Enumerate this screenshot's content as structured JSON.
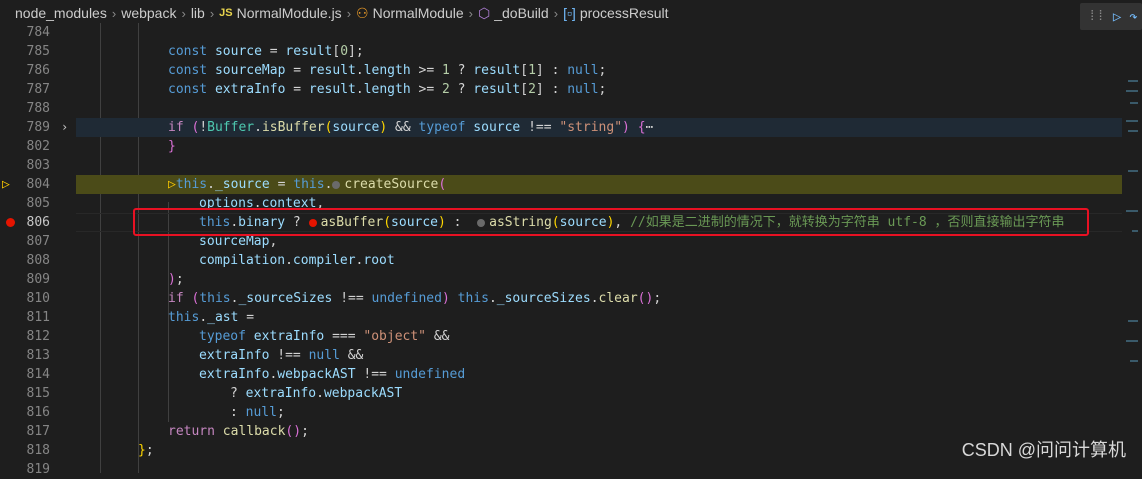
{
  "breadcrumb": {
    "items": [
      "node_modules",
      "webpack",
      "lib",
      "NormalModule.js",
      "NormalModule",
      "_doBuild",
      "processResult"
    ],
    "js_badge": "JS"
  },
  "debug_toolbar": {
    "grip": "⁞⁞",
    "continue": "▷",
    "step_over": "↷"
  },
  "lines": [
    {
      "n": "784",
      "segs": []
    },
    {
      "n": "785",
      "segs": [
        [
          "kw",
          "const "
        ],
        [
          "var",
          "source"
        ],
        [
          "pun",
          " = "
        ],
        [
          "var",
          "result"
        ],
        [
          "pun",
          "["
        ],
        [
          "num",
          "0"
        ],
        [
          "pun",
          "];"
        ]
      ]
    },
    {
      "n": "786",
      "segs": [
        [
          "kw",
          "const "
        ],
        [
          "var",
          "sourceMap"
        ],
        [
          "pun",
          " = "
        ],
        [
          "var",
          "result"
        ],
        [
          "pun",
          "."
        ],
        [
          "var",
          "length"
        ],
        [
          "pun",
          " >= "
        ],
        [
          "num",
          "1"
        ],
        [
          "pun",
          " ? "
        ],
        [
          "var",
          "result"
        ],
        [
          "pun",
          "["
        ],
        [
          "num",
          "1"
        ],
        [
          "pun",
          "] : "
        ],
        [
          "kw",
          "null"
        ],
        [
          "pun",
          ";"
        ]
      ]
    },
    {
      "n": "787",
      "segs": [
        [
          "kw",
          "const "
        ],
        [
          "var",
          "extraInfo"
        ],
        [
          "pun",
          " = "
        ],
        [
          "var",
          "result"
        ],
        [
          "pun",
          "."
        ],
        [
          "var",
          "length"
        ],
        [
          "pun",
          " >= "
        ],
        [
          "num",
          "2"
        ],
        [
          "pun",
          " ? "
        ],
        [
          "var",
          "result"
        ],
        [
          "pun",
          "["
        ],
        [
          "num",
          "2"
        ],
        [
          "pun",
          "] : "
        ],
        [
          "kw",
          "null"
        ],
        [
          "pun",
          ";"
        ]
      ]
    },
    {
      "n": "788",
      "segs": []
    },
    {
      "n": "789",
      "segs": [
        [
          "ctl",
          "if "
        ],
        [
          "brk2",
          "("
        ],
        [
          "pun",
          "!"
        ],
        [
          "cls",
          "Buffer"
        ],
        [
          "pun",
          "."
        ],
        [
          "fn",
          "isBuffer"
        ],
        [
          "brk",
          "("
        ],
        [
          "var",
          "source"
        ],
        [
          "brk",
          ")"
        ],
        [
          "pun",
          " && "
        ],
        [
          "kw",
          "typeof "
        ],
        [
          "var",
          "source"
        ],
        [
          "pun",
          " !== "
        ],
        [
          "str",
          "\"string\""
        ],
        [
          "brk2",
          ")"
        ],
        [
          "pun",
          " "
        ],
        [
          "brk2",
          "{"
        ],
        [
          "pun",
          "⋯"
        ]
      ]
    },
    {
      "n": "802",
      "segs": [
        [
          "brk2",
          "}"
        ]
      ]
    },
    {
      "n": "803",
      "segs": []
    },
    {
      "n": "804",
      "segs": [
        [
          "kw",
          "this"
        ],
        [
          "pun",
          "."
        ],
        [
          "var",
          "_source"
        ],
        [
          "pun",
          " = "
        ],
        [
          "kw",
          "this"
        ],
        [
          "pun",
          "."
        ],
        [
          "fn",
          "createSource"
        ],
        [
          "brk2",
          "("
        ]
      ]
    },
    {
      "n": "805",
      "segs": [
        [
          "var",
          "options"
        ],
        [
          "pun",
          "."
        ],
        [
          "var",
          "context"
        ],
        [
          "pun",
          ","
        ]
      ]
    },
    {
      "n": "806",
      "segs": [
        [
          "kw",
          "this"
        ],
        [
          "pun",
          "."
        ],
        [
          "var",
          "binary"
        ],
        [
          "pun",
          " ? "
        ],
        [
          "fn",
          "asBuffer"
        ],
        [
          "brk",
          "("
        ],
        [
          "var",
          "source"
        ],
        [
          "brk",
          ")"
        ],
        [
          "pun",
          " :  "
        ],
        [
          "fn",
          "asString"
        ],
        [
          "brk",
          "("
        ],
        [
          "var",
          "source"
        ],
        [
          "brk",
          ")"
        ],
        [
          "pun",
          ", "
        ],
        [
          "cmt",
          "//如果是二进制的情况下，就转换为字符串 utf-8 ，否则直接输出字符串"
        ]
      ]
    },
    {
      "n": "807",
      "segs": [
        [
          "var",
          "sourceMap"
        ],
        [
          "pun",
          ","
        ]
      ]
    },
    {
      "n": "808",
      "segs": [
        [
          "var",
          "compilation"
        ],
        [
          "pun",
          "."
        ],
        [
          "var",
          "compiler"
        ],
        [
          "pun",
          "."
        ],
        [
          "var",
          "root"
        ]
      ]
    },
    {
      "n": "809",
      "segs": [
        [
          "brk2",
          ")"
        ],
        [
          "pun",
          ";"
        ]
      ]
    },
    {
      "n": "810",
      "segs": [
        [
          "ctl",
          "if "
        ],
        [
          "brk2",
          "("
        ],
        [
          "kw",
          "this"
        ],
        [
          "pun",
          "."
        ],
        [
          "var",
          "_sourceSizes"
        ],
        [
          "pun",
          " !== "
        ],
        [
          "kw",
          "undefined"
        ],
        [
          "brk2",
          ")"
        ],
        [
          "pun",
          " "
        ],
        [
          "kw",
          "this"
        ],
        [
          "pun",
          "."
        ],
        [
          "var",
          "_sourceSizes"
        ],
        [
          "pun",
          "."
        ],
        [
          "fn",
          "clear"
        ],
        [
          "brk2",
          "()"
        ],
        [
          "pun",
          ";"
        ]
      ]
    },
    {
      "n": "811",
      "segs": [
        [
          "kw",
          "this"
        ],
        [
          "pun",
          "."
        ],
        [
          "var",
          "_ast"
        ],
        [
          "pun",
          " ="
        ]
      ]
    },
    {
      "n": "812",
      "segs": [
        [
          "kw",
          "typeof "
        ],
        [
          "var",
          "extraInfo"
        ],
        [
          "pun",
          " === "
        ],
        [
          "str",
          "\"object\""
        ],
        [
          "pun",
          " &&"
        ]
      ]
    },
    {
      "n": "813",
      "segs": [
        [
          "var",
          "extraInfo"
        ],
        [
          "pun",
          " !== "
        ],
        [
          "kw",
          "null"
        ],
        [
          "pun",
          " &&"
        ]
      ]
    },
    {
      "n": "814",
      "segs": [
        [
          "var",
          "extraInfo"
        ],
        [
          "pun",
          "."
        ],
        [
          "var",
          "webpackAST"
        ],
        [
          "pun",
          " !== "
        ],
        [
          "kw",
          "undefined"
        ]
      ]
    },
    {
      "n": "815",
      "segs": [
        [
          "pun",
          "? "
        ],
        [
          "var",
          "extraInfo"
        ],
        [
          "pun",
          "."
        ],
        [
          "var",
          "webpackAST"
        ]
      ]
    },
    {
      "n": "816",
      "segs": [
        [
          "pun",
          ": "
        ],
        [
          "kw",
          "null"
        ],
        [
          "pun",
          ";"
        ]
      ]
    },
    {
      "n": "817",
      "segs": [
        [
          "ctl",
          "return "
        ],
        [
          "fn",
          "callback"
        ],
        [
          "brk2",
          "()"
        ],
        [
          "pun",
          ";"
        ]
      ]
    },
    {
      "n": "818",
      "segs": [
        [
          "brk",
          "}"
        ],
        [
          "pun",
          ";"
        ]
      ]
    },
    {
      "n": "819",
      "segs": []
    }
  ],
  "watermark": "CSDN @问问计算机"
}
